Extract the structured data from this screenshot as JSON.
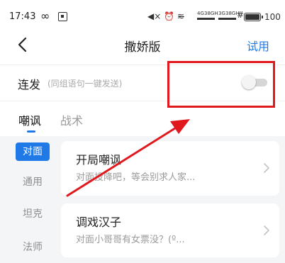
{
  "status_bar": {
    "time": "17:43",
    "infinity": "∞",
    "icons_text": "◀× ⏰ ≋̶",
    "net_1_top": "4G",
    "net_1_unit": "38GH",
    "net_2_top": "3G",
    "net_2_unit": "38GH",
    "battery": "100"
  },
  "nav": {
    "title": "撒娇版",
    "trial": "试用"
  },
  "continuous_send": {
    "label": "连发",
    "hint": "(同组语句一键发送)",
    "enabled": false
  },
  "tabs": [
    {
      "label": "嘲讽",
      "active": true
    },
    {
      "label": "战术",
      "active": false
    }
  ],
  "side_categories": [
    {
      "label": "对面",
      "active": true
    },
    {
      "label": "通用",
      "active": false
    },
    {
      "label": "坦克",
      "active": false
    },
    {
      "label": "法师",
      "active": false
    }
  ],
  "cards": [
    {
      "title": "开局嘲讽",
      "desc": "对面投降吧，等会别求人家..."
    },
    {
      "title": "调戏汉子",
      "desc": "对面小哥哥有女票没？(º..."
    }
  ],
  "colors": {
    "accent": "#1f7ae8",
    "annotation": "#e0191f"
  }
}
